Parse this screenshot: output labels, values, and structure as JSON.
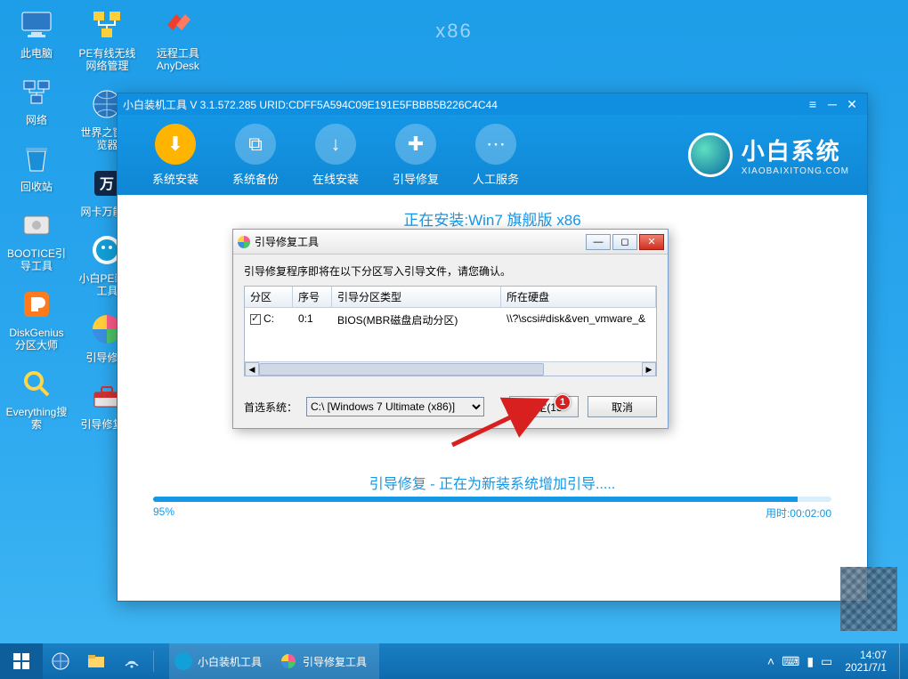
{
  "watermark": "x86",
  "desktop_icons": {
    "col1": [
      {
        "label": "此电脑"
      },
      {
        "label": "网络"
      },
      {
        "label": "回收站"
      },
      {
        "label": "BOOTICE引导工具"
      },
      {
        "label": "DiskGenius分区大师"
      },
      {
        "label": "Everything搜索"
      }
    ],
    "col2": [
      {
        "label": "PE有线无线网络管理"
      },
      {
        "label": "世界之窗浏览器"
      },
      {
        "label": "网卡万能驱"
      },
      {
        "label": "小白PE装机工具"
      },
      {
        "label": "引导修复"
      },
      {
        "label": "引导修复工"
      }
    ],
    "col3": [
      {
        "label": "远程工具AnyDesk"
      }
    ]
  },
  "app": {
    "title": "小白装机工具 V 3.1.572.285 URID:CDFF5A594C09E191E5FBBB5B226C4C44",
    "toolbar": [
      {
        "label": "系统安装"
      },
      {
        "label": "系统备份"
      },
      {
        "label": "在线安装"
      },
      {
        "label": "引导修复"
      },
      {
        "label": "人工服务"
      }
    ],
    "brand": {
      "name": "小白系统",
      "sub": "XIAOBAIXITONG.COM"
    },
    "installing": "正在安装:Win7 旗舰版 x86",
    "status": "引导修复 - 正在为新装系统增加引导.....",
    "progress": {
      "percent": 95,
      "percent_label": "95%",
      "time_label": "用时:00:02:00"
    }
  },
  "dialog": {
    "title": "引导修复工具",
    "message": "引导修复程序即将在以下分区写入引导文件，请您确认。",
    "columns": {
      "c1": "分区",
      "c2": "序号",
      "c3": "引导分区类型",
      "c4": "所在硬盘"
    },
    "row": {
      "checked": true,
      "drive": "C:",
      "index": "0:1",
      "type": "BIOS(MBR磁盘启动分区)",
      "disk": "\\\\?\\scsi#disk&ven_vmware_&"
    },
    "preferred_label": "首选系统：",
    "preferred_value": "C:\\ [Windows 7 Ultimate (x86)]",
    "ok_label": "确定(15",
    "cancel_label": "取消"
  },
  "badge_number": "1",
  "taskbar": {
    "task1": "小白装机工具",
    "task2": "引导修复工具",
    "clock_time": "14:07",
    "clock_date": "2021/7/1"
  }
}
